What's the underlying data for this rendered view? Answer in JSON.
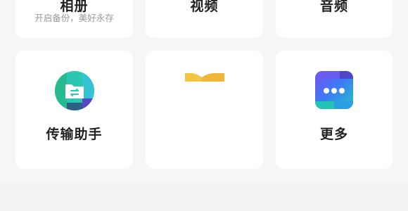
{
  "cards_top": [
    {
      "title": "相册",
      "subtitle": "开启备份，美好永存"
    },
    {
      "title": "视频"
    },
    {
      "title": "音频"
    }
  ],
  "cards_bottom": [
    {
      "title": "传输助手",
      "icon": "transfer-folder-icon"
    },
    {
      "title": "",
      "icon": "partial-yellow-icon"
    },
    {
      "title": "更多",
      "icon": "more-dots-icon"
    }
  ],
  "colors": {
    "background": "#f6f6f8",
    "card": "#ffffff",
    "title": "#222222",
    "subtitle": "#9a9a9a",
    "transfer_teal": "#2cc7b0",
    "more_purple": "#6a5cf2",
    "yellow": "#f4c443"
  }
}
